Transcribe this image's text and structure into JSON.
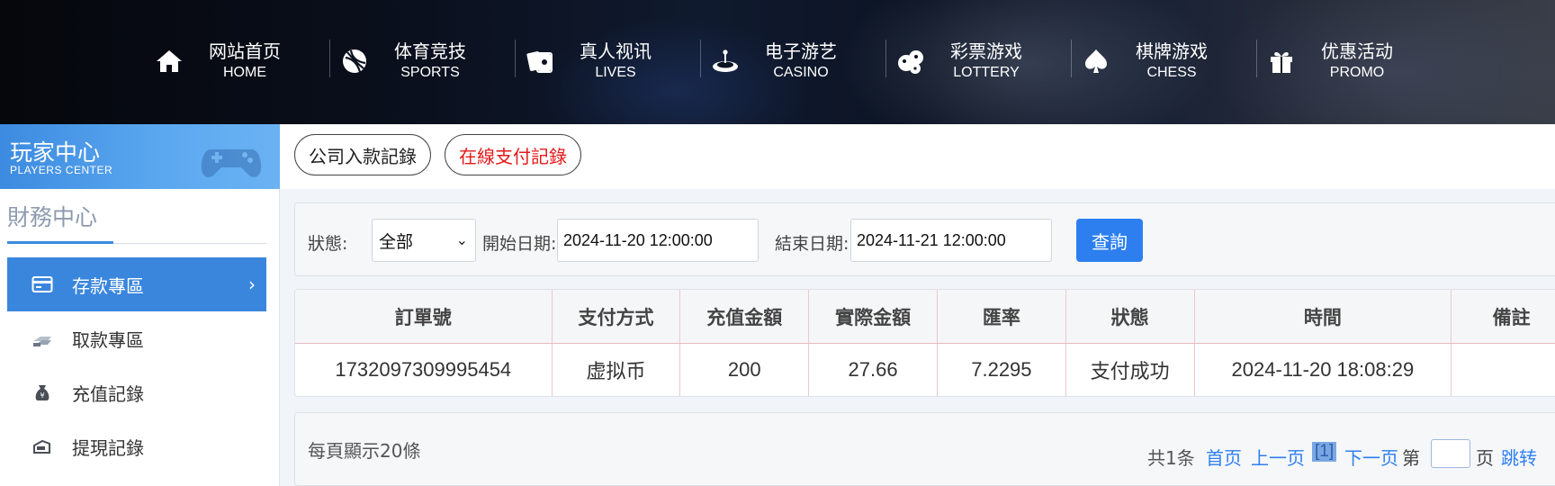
{
  "nav": [
    {
      "cn": "网站首页",
      "en": "HOME",
      "icon": "home-icon"
    },
    {
      "cn": "体育竞技",
      "en": "SPORTS",
      "icon": "ball-icon"
    },
    {
      "cn": "真人视讯",
      "en": "LIVES",
      "icon": "cards-icon"
    },
    {
      "cn": "电子游艺",
      "en": "CASINO",
      "icon": "roulette-icon"
    },
    {
      "cn": "彩票游戏",
      "en": "LOTTERY",
      "icon": "dice-icon"
    },
    {
      "cn": "棋牌游戏",
      "en": "CHESS",
      "icon": "spade-icon"
    },
    {
      "cn": "优惠活动",
      "en": "PROMO",
      "icon": "gift-icon"
    }
  ],
  "sidebar": {
    "banner_cn": "玩家中心",
    "banner_en": "PLAYERS CENTER",
    "section_title": "財務中心",
    "items": [
      {
        "label": "存款專區",
        "icon": "deposit-card-icon",
        "active": true
      },
      {
        "label": "取款專區",
        "icon": "withdraw-cash-icon",
        "active": false
      },
      {
        "label": "充值記錄",
        "icon": "money-bag-icon",
        "active": false
      },
      {
        "label": "提現記錄",
        "icon": "withdraw-record-icon",
        "active": false
      }
    ]
  },
  "tabs": {
    "company_deposit": "公司入款記錄",
    "online_payment": "在線支付記錄"
  },
  "filter": {
    "status_label": "狀態:",
    "status_value": "全部",
    "start_label": "開始日期:",
    "start_value": "2024-11-20 12:00:00",
    "end_label": "結束日期:",
    "end_value": "2024-11-21 12:00:00",
    "query_button": "查詢"
  },
  "table": {
    "headers": [
      "訂單號",
      "支付方式",
      "充值金額",
      "實際金額",
      "匯率",
      "狀態",
      "時間",
      "備註"
    ],
    "rows": [
      [
        "1732097309995454",
        "虚拟币",
        "200",
        "27.66",
        "7.2295",
        "支付成功",
        "2024-11-20 18:08:29",
        ""
      ]
    ]
  },
  "pager": {
    "per_page": "每頁顯示20條",
    "total": "共1条",
    "first": "首页",
    "prev": "上一页",
    "current": "[1]",
    "next": "下一页",
    "page_prefix": "第",
    "page_suffix": "页",
    "jump": "跳转"
  },
  "colors": {
    "accent": "#2d7ff0",
    "sidebar_active": "#3a86dd",
    "tab_online_text": "#e21a1a"
  }
}
